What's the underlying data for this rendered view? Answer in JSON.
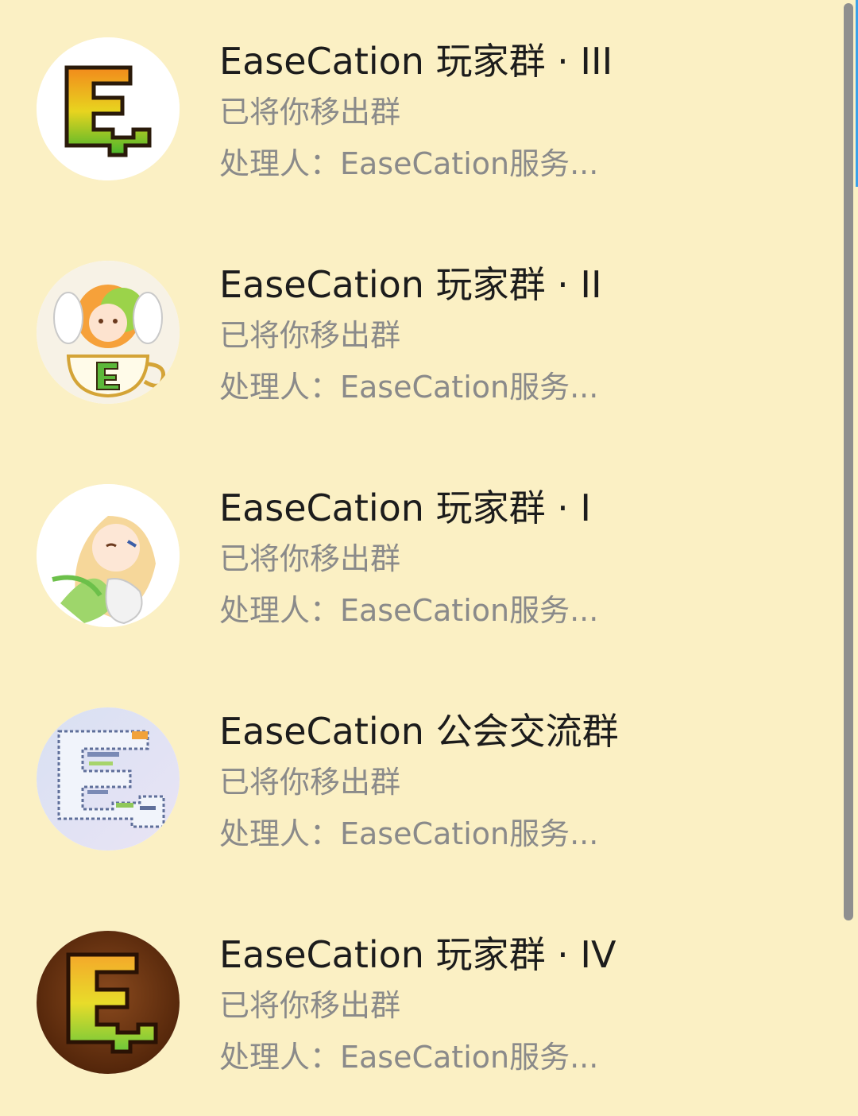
{
  "groups": [
    {
      "title": "EaseCation 玩家群 · III",
      "status": "已将你移出群",
      "handler": "处理人：EaseCation服务...",
      "icon": "easecation-logo-white-icon"
    },
    {
      "title": "EaseCation 玩家群 · II",
      "status": "已将你移出群",
      "handler": "处理人：EaseCation服务...",
      "icon": "anime-teacup-avatar-icon"
    },
    {
      "title": "EaseCation 玩家群 · I",
      "status": "已将你移出群",
      "handler": "处理人：EaseCation服务...",
      "icon": "anime-girl-avatar-icon"
    },
    {
      "title": "EaseCation 公会交流群",
      "status": "已将你移出群",
      "handler": "处理人：EaseCation服务...",
      "icon": "word-cloud-logo-icon"
    },
    {
      "title": "EaseCation 玩家群 · IV",
      "status": "已将你移出群",
      "handler": "处理人：EaseCation服务...",
      "icon": "easecation-logo-brown-icon"
    }
  ],
  "colors": {
    "background": "#fbf0c4",
    "title": "#1c1c1c",
    "secondary": "#8a8a8a",
    "scrollbar": "#8f8f8f",
    "accent": "#3aa0e8"
  }
}
